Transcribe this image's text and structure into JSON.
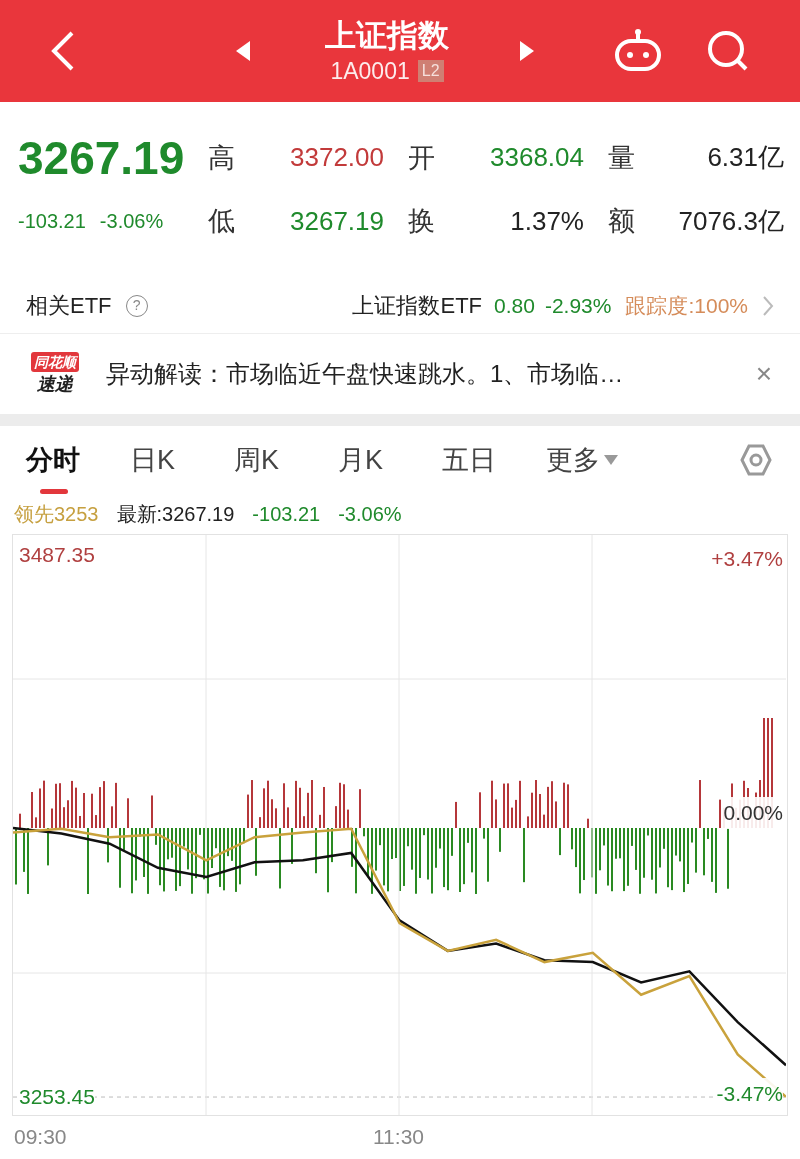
{
  "header": {
    "title": "上证指数",
    "code": "1A0001",
    "badge": "L2"
  },
  "quote": {
    "price": "3267.19",
    "change": "-103.21",
    "change_pct": "-3.06%",
    "color": "#1f8a2c",
    "stats": [
      {
        "label": "高",
        "value": "3372.00",
        "color": "#c23a3a"
      },
      {
        "label": "开",
        "value": "3368.04",
        "color": "#1f8a2c"
      },
      {
        "label": "量",
        "value": "6.31亿",
        "color": "#222222"
      },
      {
        "label": "低",
        "value": "3267.19",
        "color": "#1f8a2c"
      },
      {
        "label": "换",
        "value": "1.37%",
        "color": "#222222"
      },
      {
        "label": "额",
        "value": "7076.3亿",
        "color": "#222222"
      }
    ]
  },
  "etf": {
    "label": "相关ETF",
    "help": "?",
    "name": "上证指数ETF",
    "price": "0.80",
    "change_pct": "-2.93%",
    "color": "#1f8a2c",
    "tracking": "跟踪度:100%"
  },
  "news": {
    "logo_top": "同花顺",
    "logo_bottom": "速递",
    "text": "异动解读：市场临近午盘快速跳水。1、市场临…",
    "close": "×"
  },
  "tabs": [
    {
      "label": "分时",
      "selected": true,
      "kind": "tab"
    },
    {
      "label": "日K",
      "selected": false,
      "kind": "tab"
    },
    {
      "label": "周K",
      "selected": false,
      "kind": "tab"
    },
    {
      "label": "月K",
      "selected": false,
      "kind": "tab"
    },
    {
      "label": "五日",
      "selected": false,
      "kind": "tab"
    },
    {
      "label": "更多",
      "selected": false,
      "kind": "dropdown"
    }
  ],
  "chart": {
    "leader": "领先3253",
    "latest": "最新:3267.19",
    "change": "-103.21",
    "change_pct": "-3.06%",
    "color": "#1f8a2c",
    "y_top_pct": "+3.47%",
    "mid_pct": "0.00%",
    "y_bottom_pct": "-3.47%",
    "times": [
      "09:30",
      "11:30"
    ],
    "chart_data": {
      "type": "line",
      "ylim": [
        3245.7,
        3496.0
      ],
      "yticks": [
        {
          "value": 3253.45,
          "label": "3253.45"
        },
        {
          "value": 3487.35,
          "label": "3487.35"
        }
      ],
      "grid": true,
      "series": [
        {
          "color": "#111111",
          "values": [
            3369.6,
            3367.2,
            3362.8,
            3352.4,
            3348.4,
            3354.8,
            3355.6,
            3358.8,
            3329.7,
            3316.5,
            3319.7,
            3312.5,
            3311.7,
            3302.9,
            3307.7,
            3285.8,
            3267.2
          ]
        },
        {
          "color": "#c9a23c",
          "values": [
            3367.6,
            3369.2,
            3365.6,
            3366.8,
            3355.6,
            3365.6,
            3367.6,
            3369.2,
            3328.5,
            3316.5,
            3321.3,
            3311.7,
            3315.7,
            3297.6,
            3305.7,
            3271.8,
            3253.5
          ]
        }
      ]
    }
  }
}
